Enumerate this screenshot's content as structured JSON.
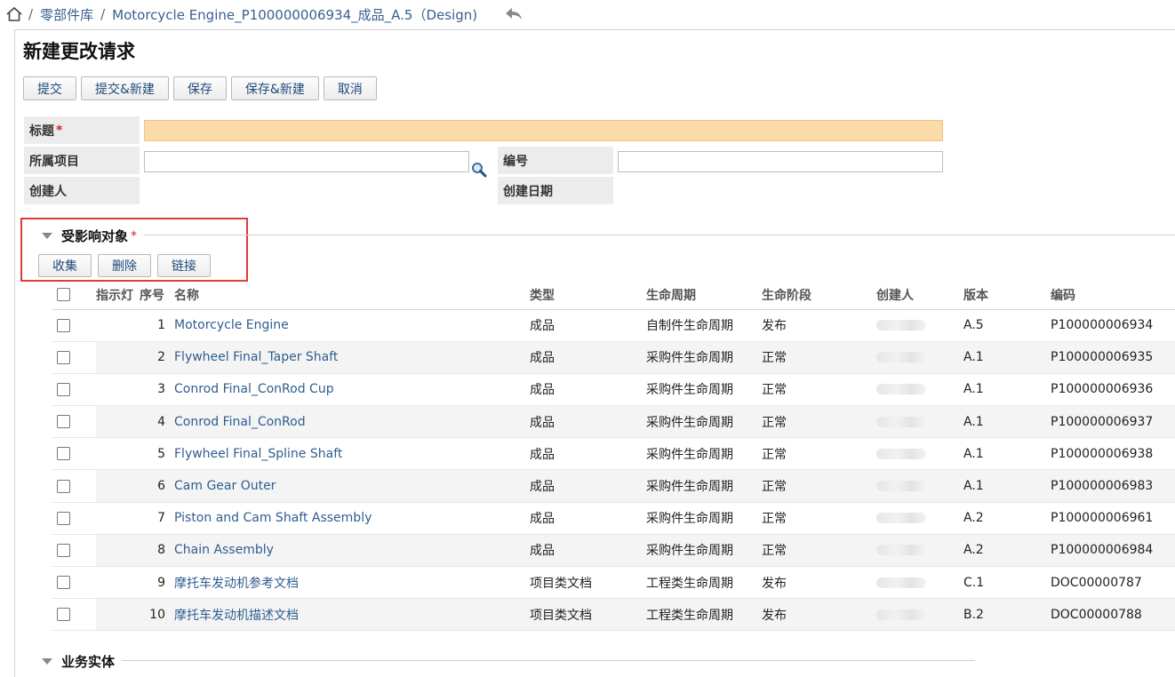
{
  "breadcrumb": {
    "sep": "/",
    "items": [
      "零部件库",
      "Motorcycle Engine_P100000006934_成品_A.5（Design)"
    ]
  },
  "page": {
    "title": "新建更改请求"
  },
  "toolbar": {
    "buttons": [
      "提交",
      "提交&新建",
      "保存",
      "保存&新建",
      "取消"
    ]
  },
  "form": {
    "required_mark": "*",
    "title_label": "标题",
    "title_value": "",
    "project_label": "所属项目",
    "project_value": "",
    "number_label": "编号",
    "number_value": "",
    "creator_label": "创建人",
    "created_date_label": "创建日期"
  },
  "affected_section": {
    "title": "受影响对象",
    "required_mark": "*",
    "buttons": [
      "收集",
      "删除",
      "链接"
    ]
  },
  "table": {
    "headers": {
      "indicator": "指示灯",
      "seq": "序号",
      "name": "名称",
      "type": "类型",
      "lifecycle": "生命周期",
      "stage": "生命阶段",
      "creator": "创建人",
      "version": "版本",
      "code": "编码"
    },
    "rows": [
      {
        "seq": "1",
        "name": "Motorcycle Engine",
        "type": "成品",
        "lifecycle": "自制件生命周期",
        "stage": "发布",
        "version": "A.5",
        "code": "P100000006934"
      },
      {
        "seq": "2",
        "name": "Flywheel Final_Taper Shaft",
        "type": "成品",
        "lifecycle": "采购件生命周期",
        "stage": "正常",
        "version": "A.1",
        "code": "P100000006935"
      },
      {
        "seq": "3",
        "name": "Conrod Final_ConRod Cup",
        "type": "成品",
        "lifecycle": "采购件生命周期",
        "stage": "正常",
        "version": "A.1",
        "code": "P100000006936"
      },
      {
        "seq": "4",
        "name": "Conrod Final_ConRod",
        "type": "成品",
        "lifecycle": "采购件生命周期",
        "stage": "正常",
        "version": "A.1",
        "code": "P100000006937"
      },
      {
        "seq": "5",
        "name": "Flywheel Final_Spline Shaft",
        "type": "成品",
        "lifecycle": "采购件生命周期",
        "stage": "正常",
        "version": "A.1",
        "code": "P100000006938"
      },
      {
        "seq": "6",
        "name": "Cam Gear Outer",
        "type": "成品",
        "lifecycle": "采购件生命周期",
        "stage": "正常",
        "version": "A.1",
        "code": "P100000006983"
      },
      {
        "seq": "7",
        "name": "Piston and Cam Shaft Assembly",
        "type": "成品",
        "lifecycle": "采购件生命周期",
        "stage": "正常",
        "version": "A.2",
        "code": "P100000006961"
      },
      {
        "seq": "8",
        "name": "Chain Assembly",
        "type": "成品",
        "lifecycle": "采购件生命周期",
        "stage": "正常",
        "version": "A.2",
        "code": "P100000006984"
      },
      {
        "seq": "9",
        "name": "摩托车发动机参考文档",
        "type": "项目类文档",
        "lifecycle": "工程类生命周期",
        "stage": "发布",
        "version": "C.1",
        "code": "DOC00000787"
      },
      {
        "seq": "10",
        "name": "摩托车发动机描述文档",
        "type": "项目类文档",
        "lifecycle": "工程类生命周期",
        "stage": "发布",
        "version": "B.2",
        "code": "DOC00000788"
      }
    ]
  },
  "business_section": {
    "title": "业务实体"
  },
  "colors": {
    "link": "#2f5d8f",
    "required_bg": "#fddba8",
    "highlight": "#e03a3a"
  }
}
